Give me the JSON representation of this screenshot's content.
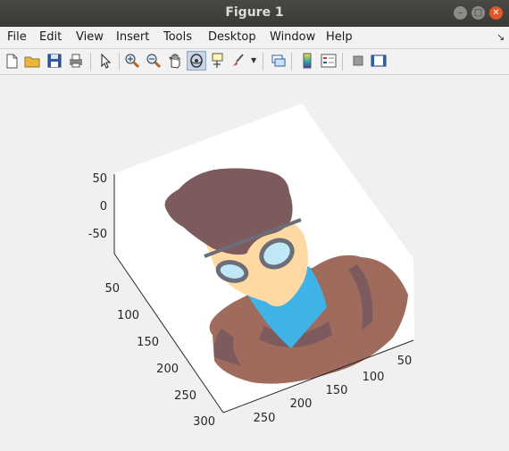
{
  "window": {
    "title": "Figure 1"
  },
  "menus": [
    "File",
    "Edit",
    "View",
    "Insert",
    "Tools",
    "Desktop",
    "Window",
    "Help"
  ],
  "toolbar": {
    "buttons": [
      "new-figure",
      "open-file",
      "save",
      "print",
      "edit-plot",
      "zoom-in",
      "zoom-out",
      "pan",
      "rotate-3d",
      "data-cursor",
      "brush",
      "link-plot",
      "insert-colorbar",
      "insert-legend",
      "hide-plot-tools",
      "show-plot-tools"
    ],
    "active": "rotate-3d"
  },
  "axes": {
    "z_ticks": [
      "50",
      "0",
      "-50"
    ],
    "y_ticks": [
      "50",
      "100",
      "150",
      "200",
      "250",
      "300"
    ],
    "x_ticks": [
      "250",
      "200",
      "150",
      "100",
      "50"
    ]
  },
  "image": {
    "subject": "cartoon man with glasses",
    "colors": {
      "hair": "#7d5a5e",
      "skin": "#ffd9a3",
      "shirt": "#3fb3e6",
      "sweater": "#9e6b5c",
      "sweater_dark": "#7d5a5e",
      "glasses": "#6d6d78",
      "lens": "#bfe8f7"
    }
  }
}
